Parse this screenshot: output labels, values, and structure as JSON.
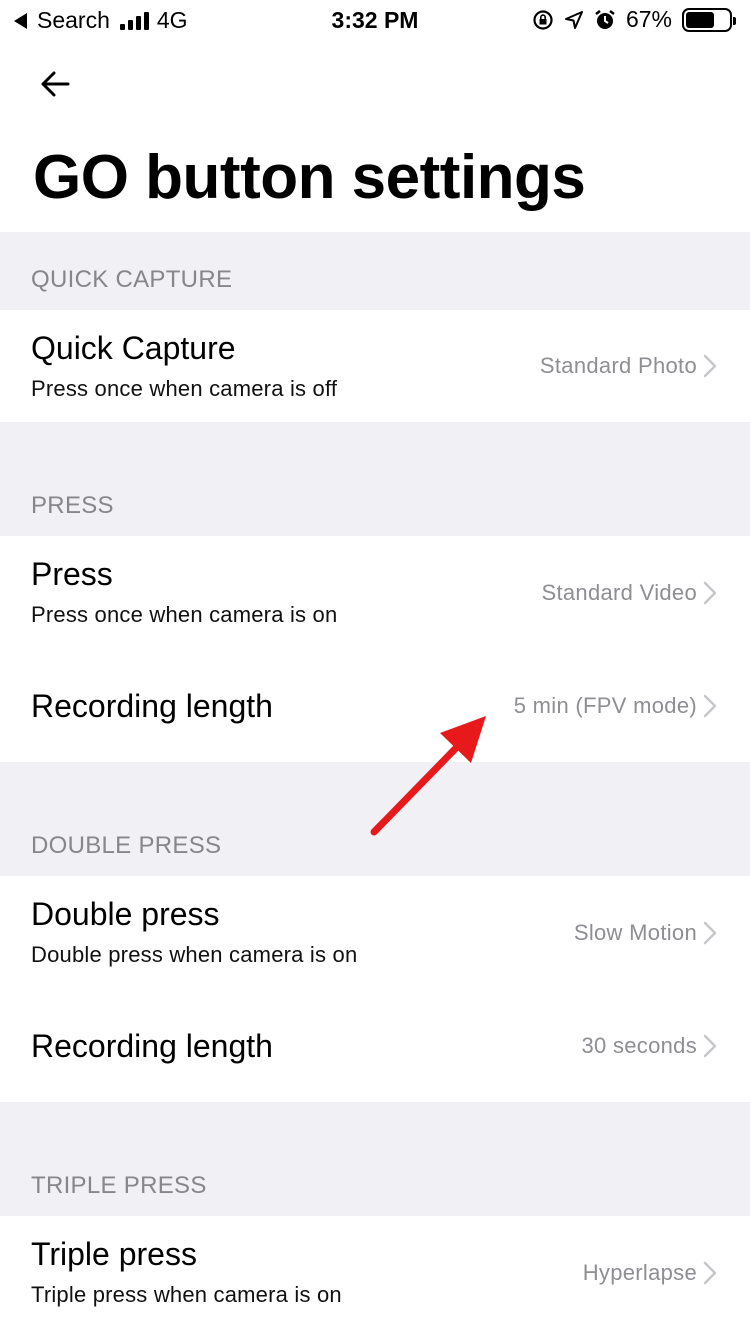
{
  "status_bar": {
    "back_app": "Search",
    "network": "4G",
    "time": "3:32 PM",
    "battery": "67%",
    "battery_level": 0.67
  },
  "page": {
    "title": "GO button settings"
  },
  "sections": {
    "quick_capture": {
      "header": "QUICK CAPTURE",
      "rows": [
        {
          "title": "Quick Capture",
          "subtitle": "Press once when camera is off",
          "value": "Standard Photo"
        }
      ]
    },
    "press": {
      "header": "PRESS",
      "rows": [
        {
          "title": "Press",
          "subtitle": "Press once when camera is on",
          "value": "Standard Video"
        },
        {
          "title": "Recording length",
          "value": "5 min (FPV mode)"
        }
      ]
    },
    "double_press": {
      "header": "DOUBLE PRESS",
      "rows": [
        {
          "title": "Double press",
          "subtitle": "Double press when camera is on",
          "value": "Slow Motion"
        },
        {
          "title": "Recording length",
          "value": "30 seconds"
        }
      ]
    },
    "triple_press": {
      "header": "TRIPLE PRESS",
      "rows": [
        {
          "title": "Triple press",
          "subtitle": "Triple press when camera is on",
          "value": "Hyperlapse"
        }
      ]
    }
  },
  "annotation": {
    "color": "#e8191a"
  }
}
